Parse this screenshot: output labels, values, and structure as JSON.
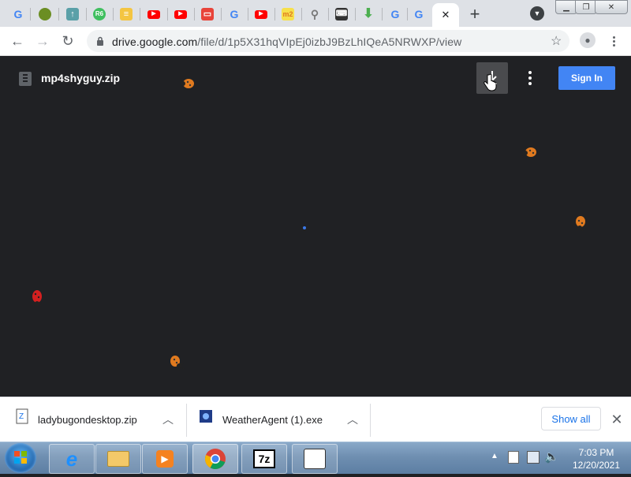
{
  "browser": {
    "url_host": "drive.google.com",
    "url_path": "/file/d/1p5X31hqVIpEj0izbJ9BzLhIQeA5NRWXP/view",
    "tab_icons": [
      "google-icon",
      "shrek-icon",
      "upload-icon",
      "app-icon",
      "note-icon",
      "youtube-icon",
      "youtube-icon",
      "store-icon",
      "google-icon",
      "youtube-icon",
      "m2-icon",
      "search-icon",
      "keyboard-icon",
      "download-icon",
      "google-icon",
      "google-icon"
    ],
    "active_tab_close": "✕",
    "new_tab": "+"
  },
  "drive": {
    "file_name": "mp4shyguy.zip",
    "sign_in_label": "Sign In"
  },
  "downloads": {
    "items": [
      {
        "name": "ladybugondesktop.zip"
      },
      {
        "name": "WeatherAgent (1).exe"
      }
    ],
    "show_all_label": "Show all"
  },
  "taskbar": {
    "time": "7:03 PM",
    "date": "12/20/2021",
    "apps": [
      "internet-explorer-icon",
      "file-explorer-icon",
      "media-player-icon",
      "chrome-icon",
      "7zip-icon",
      "ladybug-app-icon"
    ]
  },
  "colors": {
    "drive_bg": "#202124",
    "sign_in_blue": "#4285f4",
    "ladybug_orange": "#e07a1f",
    "ladybug_red": "#d42020"
  }
}
